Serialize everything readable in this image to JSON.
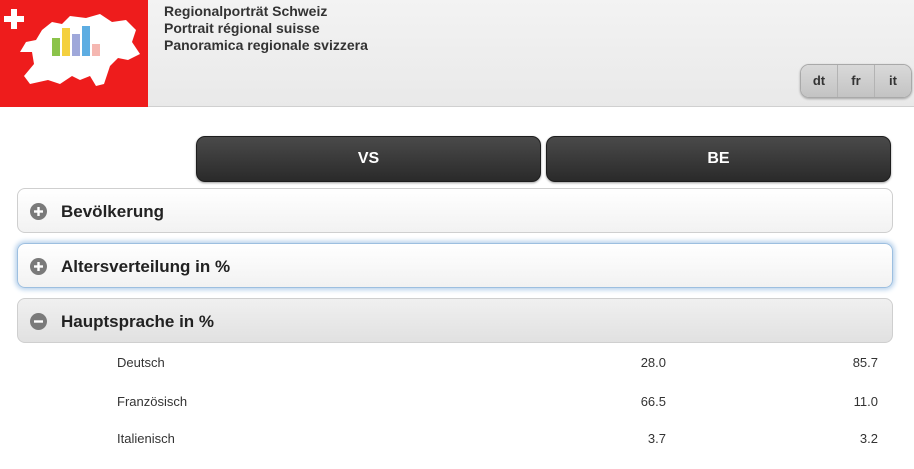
{
  "header": {
    "titles": [
      "Regionalporträt Schweiz",
      "Portrait régional suisse",
      "Panoramica regionale svizzera"
    ],
    "languages": [
      "dt",
      "fr",
      "it"
    ]
  },
  "cantons": [
    "VS",
    "BE"
  ],
  "sections": [
    {
      "label": "Bevölkerung",
      "icon": "plus-icon",
      "state": "collapsed"
    },
    {
      "label": "Altersverteilung in %",
      "icon": "plus-icon",
      "state": "collapsed-focused"
    },
    {
      "label": "Hauptsprache in %",
      "icon": "minus-icon",
      "state": "expanded"
    }
  ],
  "language_table": {
    "rows": [
      {
        "name": "Deutsch",
        "vs": "28.0",
        "be": "85.7"
      },
      {
        "name": "Französisch",
        "vs": "66.5",
        "be": "11.0"
      },
      {
        "name": "Italienisch",
        "vs": "3.7",
        "be": "3.2"
      }
    ]
  },
  "colors": {
    "flag_red": "#ee1c1c",
    "button_dark": "#333333",
    "focus_glow": "#bad3ec"
  }
}
